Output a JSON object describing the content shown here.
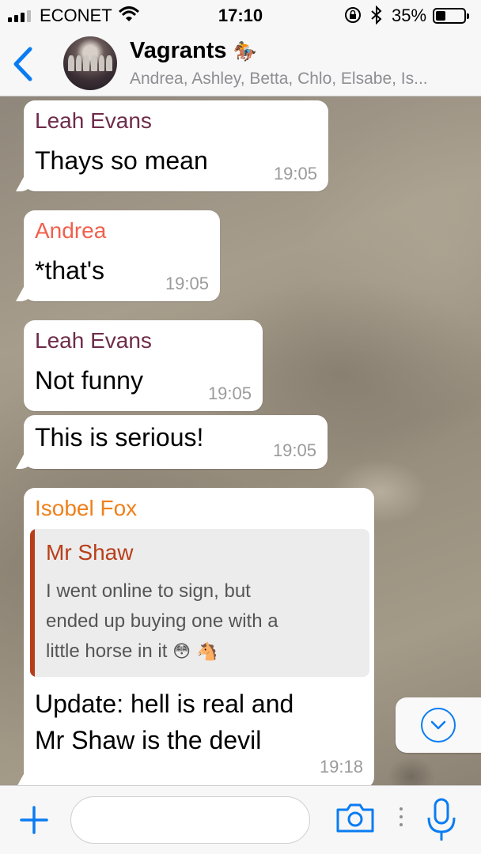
{
  "status_bar": {
    "carrier": "ECONET",
    "time": "17:10",
    "battery_percent": "35%",
    "battery_level": 0.35,
    "signal_bars_filled": 3,
    "signal_bars_total": 4
  },
  "header": {
    "group_name": "Vagrants",
    "group_emoji": "🏇",
    "members": "Andrea, Ashley, Betta, Chlo, Elsabe, Is..."
  },
  "messages": [
    {
      "sender": "Leah Evans",
      "sender_color": "#6e2c4a",
      "text": "Thays so mean",
      "time": "19:05"
    },
    {
      "sender": "Andrea",
      "sender_color": "#f0604c",
      "text": "*that's",
      "time": "19:05"
    },
    {
      "sender": "Leah Evans",
      "sender_color": "#6e2c4a",
      "text": "Not funny",
      "time": "19:05"
    },
    {
      "text": "This is serious!",
      "time": "19:05"
    },
    {
      "sender": "Isobel Fox",
      "sender_color": "#f0801a",
      "quote": {
        "sender": "Mr Shaw",
        "line1": "I went online to sign, but",
        "line2": "ended up buying one with a",
        "line3": "little horse in it",
        "emojis": "😳 🐴"
      },
      "text_line1": "Update: hell is real and",
      "text_line2": "Mr Shaw is the devil",
      "time": "19:18"
    }
  ],
  "input": {
    "placeholder": ""
  },
  "colors": {
    "accent": "#0a7cf2",
    "quote_accent": "#b83e1a"
  },
  "icons": [
    "back-chevron-icon",
    "wifi-icon",
    "rotation-lock-icon",
    "bluetooth-icon",
    "battery-icon",
    "scroll-down-icon",
    "plus-icon",
    "camera-icon",
    "more-dots-icon",
    "microphone-icon"
  ]
}
